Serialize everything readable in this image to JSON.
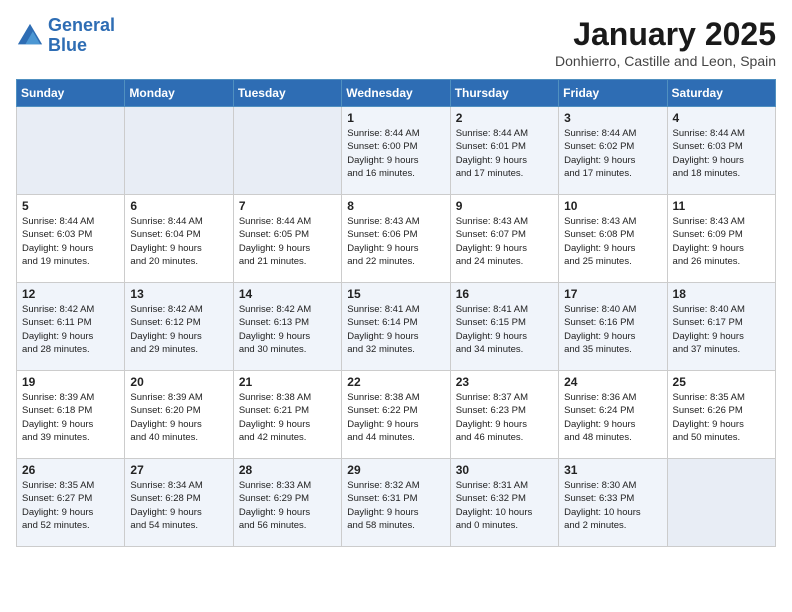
{
  "logo": {
    "line1": "General",
    "line2": "Blue"
  },
  "title": "January 2025",
  "subtitle": "Donhierro, Castille and Leon, Spain",
  "days_of_week": [
    "Sunday",
    "Monday",
    "Tuesday",
    "Wednesday",
    "Thursday",
    "Friday",
    "Saturday"
  ],
  "weeks": [
    [
      {
        "day": "",
        "info": ""
      },
      {
        "day": "",
        "info": ""
      },
      {
        "day": "",
        "info": ""
      },
      {
        "day": "1",
        "info": "Sunrise: 8:44 AM\nSunset: 6:00 PM\nDaylight: 9 hours\nand 16 minutes."
      },
      {
        "day": "2",
        "info": "Sunrise: 8:44 AM\nSunset: 6:01 PM\nDaylight: 9 hours\nand 17 minutes."
      },
      {
        "day": "3",
        "info": "Sunrise: 8:44 AM\nSunset: 6:02 PM\nDaylight: 9 hours\nand 17 minutes."
      },
      {
        "day": "4",
        "info": "Sunrise: 8:44 AM\nSunset: 6:03 PM\nDaylight: 9 hours\nand 18 minutes."
      }
    ],
    [
      {
        "day": "5",
        "info": "Sunrise: 8:44 AM\nSunset: 6:03 PM\nDaylight: 9 hours\nand 19 minutes."
      },
      {
        "day": "6",
        "info": "Sunrise: 8:44 AM\nSunset: 6:04 PM\nDaylight: 9 hours\nand 20 minutes."
      },
      {
        "day": "7",
        "info": "Sunrise: 8:44 AM\nSunset: 6:05 PM\nDaylight: 9 hours\nand 21 minutes."
      },
      {
        "day": "8",
        "info": "Sunrise: 8:43 AM\nSunset: 6:06 PM\nDaylight: 9 hours\nand 22 minutes."
      },
      {
        "day": "9",
        "info": "Sunrise: 8:43 AM\nSunset: 6:07 PM\nDaylight: 9 hours\nand 24 minutes."
      },
      {
        "day": "10",
        "info": "Sunrise: 8:43 AM\nSunset: 6:08 PM\nDaylight: 9 hours\nand 25 minutes."
      },
      {
        "day": "11",
        "info": "Sunrise: 8:43 AM\nSunset: 6:09 PM\nDaylight: 9 hours\nand 26 minutes."
      }
    ],
    [
      {
        "day": "12",
        "info": "Sunrise: 8:42 AM\nSunset: 6:11 PM\nDaylight: 9 hours\nand 28 minutes."
      },
      {
        "day": "13",
        "info": "Sunrise: 8:42 AM\nSunset: 6:12 PM\nDaylight: 9 hours\nand 29 minutes."
      },
      {
        "day": "14",
        "info": "Sunrise: 8:42 AM\nSunset: 6:13 PM\nDaylight: 9 hours\nand 30 minutes."
      },
      {
        "day": "15",
        "info": "Sunrise: 8:41 AM\nSunset: 6:14 PM\nDaylight: 9 hours\nand 32 minutes."
      },
      {
        "day": "16",
        "info": "Sunrise: 8:41 AM\nSunset: 6:15 PM\nDaylight: 9 hours\nand 34 minutes."
      },
      {
        "day": "17",
        "info": "Sunrise: 8:40 AM\nSunset: 6:16 PM\nDaylight: 9 hours\nand 35 minutes."
      },
      {
        "day": "18",
        "info": "Sunrise: 8:40 AM\nSunset: 6:17 PM\nDaylight: 9 hours\nand 37 minutes."
      }
    ],
    [
      {
        "day": "19",
        "info": "Sunrise: 8:39 AM\nSunset: 6:18 PM\nDaylight: 9 hours\nand 39 minutes."
      },
      {
        "day": "20",
        "info": "Sunrise: 8:39 AM\nSunset: 6:20 PM\nDaylight: 9 hours\nand 40 minutes."
      },
      {
        "day": "21",
        "info": "Sunrise: 8:38 AM\nSunset: 6:21 PM\nDaylight: 9 hours\nand 42 minutes."
      },
      {
        "day": "22",
        "info": "Sunrise: 8:38 AM\nSunset: 6:22 PM\nDaylight: 9 hours\nand 44 minutes."
      },
      {
        "day": "23",
        "info": "Sunrise: 8:37 AM\nSunset: 6:23 PM\nDaylight: 9 hours\nand 46 minutes."
      },
      {
        "day": "24",
        "info": "Sunrise: 8:36 AM\nSunset: 6:24 PM\nDaylight: 9 hours\nand 48 minutes."
      },
      {
        "day": "25",
        "info": "Sunrise: 8:35 AM\nSunset: 6:26 PM\nDaylight: 9 hours\nand 50 minutes."
      }
    ],
    [
      {
        "day": "26",
        "info": "Sunrise: 8:35 AM\nSunset: 6:27 PM\nDaylight: 9 hours\nand 52 minutes."
      },
      {
        "day": "27",
        "info": "Sunrise: 8:34 AM\nSunset: 6:28 PM\nDaylight: 9 hours\nand 54 minutes."
      },
      {
        "day": "28",
        "info": "Sunrise: 8:33 AM\nSunset: 6:29 PM\nDaylight: 9 hours\nand 56 minutes."
      },
      {
        "day": "29",
        "info": "Sunrise: 8:32 AM\nSunset: 6:31 PM\nDaylight: 9 hours\nand 58 minutes."
      },
      {
        "day": "30",
        "info": "Sunrise: 8:31 AM\nSunset: 6:32 PM\nDaylight: 10 hours\nand 0 minutes."
      },
      {
        "day": "31",
        "info": "Sunrise: 8:30 AM\nSunset: 6:33 PM\nDaylight: 10 hours\nand 2 minutes."
      },
      {
        "day": "",
        "info": ""
      }
    ]
  ]
}
